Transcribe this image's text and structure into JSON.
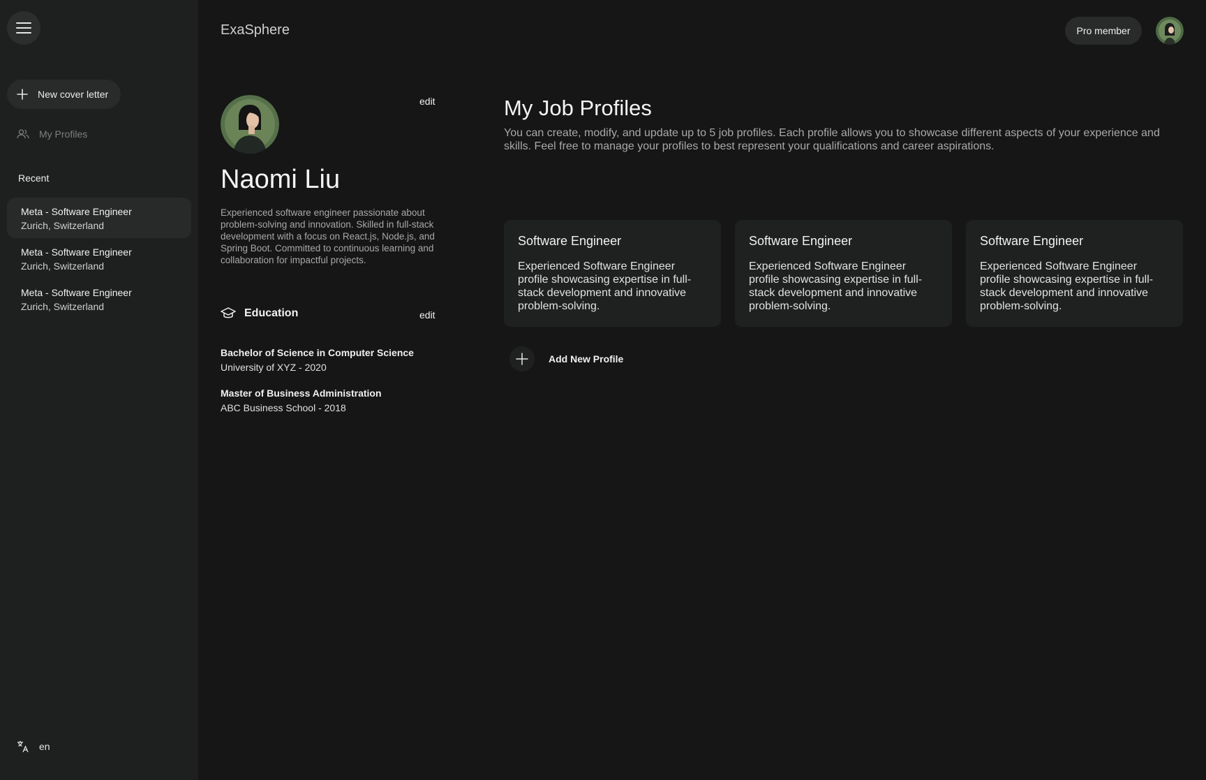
{
  "app": {
    "brand": "ExaSphere"
  },
  "header": {
    "badge": "Pro member"
  },
  "sidebar": {
    "new_cover_letter": "New cover letter",
    "my_profiles": "My Profiles",
    "recent_heading": "Recent",
    "recent": [
      {
        "title": "Meta - Software Engineer",
        "location": "Zurich, Switzerland"
      },
      {
        "title": "Meta - Software Engineer",
        "location": "Zurich, Switzerland"
      },
      {
        "title": "Meta - Software Engineer",
        "location": "Zurich, Switzerland"
      }
    ],
    "language": "en"
  },
  "profile": {
    "edit_label": "edit",
    "name": "Naomi Liu",
    "bio": "Experienced software engineer passionate about problem-solving and innovation. Skilled in full-stack development with a focus on React.js, Node.js, and Spring Boot. Committed to continuous learning and collaboration for impactful projects.",
    "education_heading": "Education",
    "education_edit": "edit",
    "education": [
      {
        "degree": "Bachelor of Science in Computer Science",
        "school": "University of XYZ - 2020"
      },
      {
        "degree": "Master of Business Administration",
        "school": "ABC Business School - 2018"
      }
    ]
  },
  "job_profiles": {
    "title": "My Job Profiles",
    "description": "You can create, modify, and update up to 5 job profiles. Each profile allows you to showcase different aspects of your experience and skills. Feel free to manage your profiles to best represent your qualifications and career aspirations.",
    "cards": [
      {
        "title": "Software Engineer",
        "description": "Experienced Software Engineer profile showcasing expertise in full-stack development and innovative problem-solving."
      },
      {
        "title": "Software Engineer",
        "description": "Experienced Software Engineer profile showcasing expertise in full-stack development and innovative problem-solving."
      },
      {
        "title": "Software Engineer",
        "description": "Experienced Software Engineer profile showcasing expertise in full-stack development and innovative problem-solving."
      }
    ],
    "add_label": "Add New Profile"
  },
  "icons": {
    "menu": "hamburger-menu-icon",
    "plus": "plus-icon",
    "profiles": "users-icon",
    "language": "translate-icon",
    "education": "graduation-cap-icon"
  },
  "colors": {
    "background": "#161616",
    "sidebar": "#1e1f1f",
    "card": "#1f2020",
    "pill": "#292a2a"
  }
}
